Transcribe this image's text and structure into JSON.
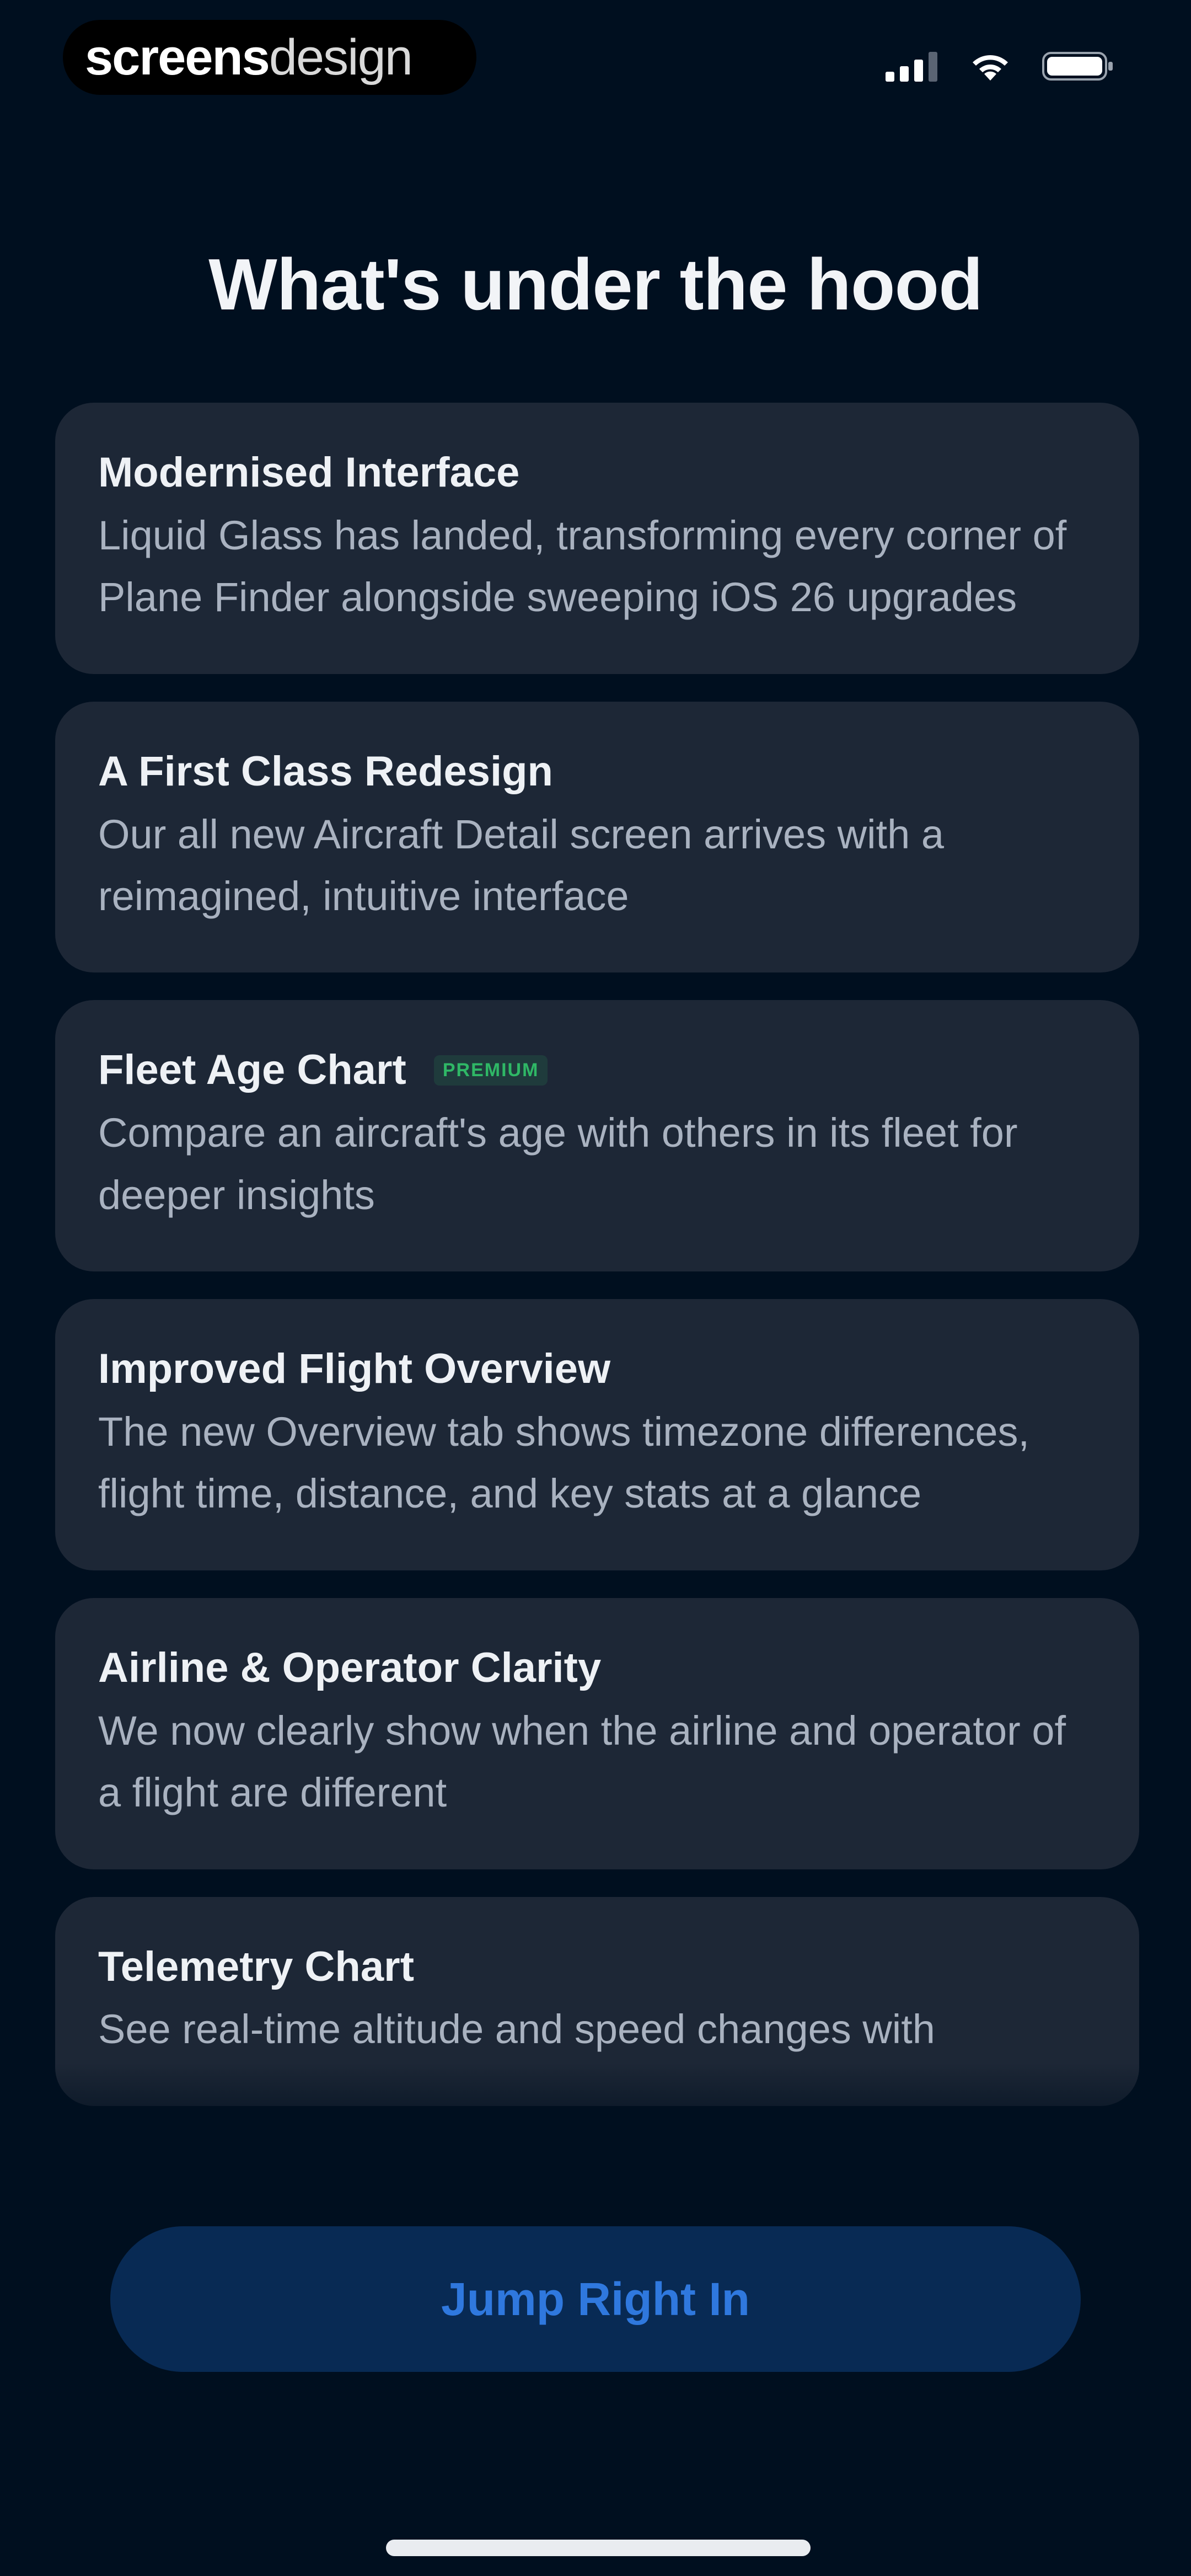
{
  "status_bar": {
    "brand_strong": "screens",
    "brand_light": "design",
    "icons": [
      "cellular-signal-icon",
      "wifi-icon",
      "battery-icon"
    ]
  },
  "header": {
    "title": "What's under the hood"
  },
  "features": [
    {
      "title": "Modernised Interface",
      "description": "Liquid Glass has landed, transforming every corner of Plane Finder alongside sweeping iOS 26 upgrades",
      "badge": ""
    },
    {
      "title": "A First Class Redesign",
      "description": "Our all new Aircraft Detail screen arrives with a reimagined, intuitive interface",
      "badge": ""
    },
    {
      "title": "Fleet Age Chart",
      "description": "Compare an aircraft's age with others in its fleet for deeper insights",
      "badge": "PREMIUM"
    },
    {
      "title": "Improved Flight Overview",
      "description": "The new Overview tab shows timezone differences, flight time, distance, and key stats at a glance",
      "badge": ""
    },
    {
      "title": "Airline & Operator Clarity",
      "description": "We now clearly show when the airline and operator of a flight are different",
      "badge": ""
    },
    {
      "title": "Telemetry Chart",
      "description": "See real-time altitude and speed changes with",
      "badge": ""
    }
  ],
  "cta": {
    "label": "Jump Right In"
  },
  "colors": {
    "background": "#000f1f",
    "card": "#1d2736",
    "accent": "#2f78de",
    "premium": "#2fb866"
  }
}
